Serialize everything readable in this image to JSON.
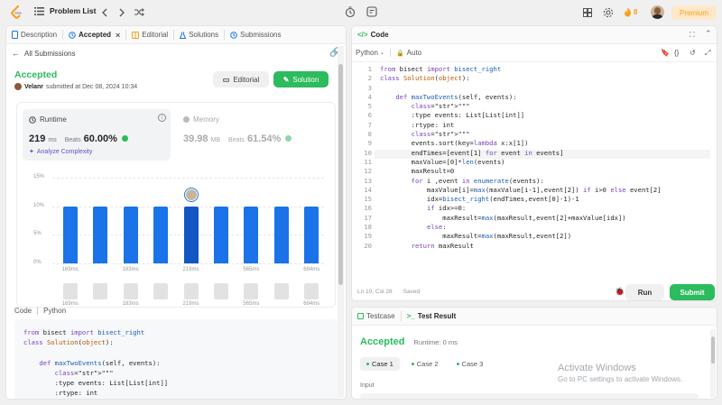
{
  "topbar": {
    "problem_list": "Problem List",
    "streak": "8",
    "premium": "Premium"
  },
  "left_tabs": [
    {
      "label": "Description"
    },
    {
      "label": "Accepted"
    },
    {
      "label": "Editorial"
    },
    {
      "label": "Solutions"
    },
    {
      "label": "Submissions"
    }
  ],
  "submission": {
    "back": "All Submissions",
    "status": "Accepted",
    "user": "Velanr",
    "submitted": "submitted at Dec 08, 2024 10:34",
    "editorial_btn": "Editorial",
    "solution_btn": "Solution",
    "runtime_label": "Runtime",
    "runtime_value": "219",
    "runtime_unit": "ms",
    "beats_label": "Beats",
    "runtime_beats": "60.00%",
    "analyze": "Analyze Complexity",
    "memory_label": "Memory",
    "memory_value": "39.98",
    "memory_unit": "MB",
    "memory_beats": "61.54%"
  },
  "chart_data": {
    "type": "bar",
    "y_ticks": [
      "15%",
      "10%",
      "5%",
      "0%"
    ],
    "ylim": [
      0,
      15
    ],
    "values": [
      10,
      10,
      10,
      10,
      10,
      10,
      10,
      10,
      10
    ],
    "highlight_index": 4,
    "x_labels": [
      "169ms",
      "",
      "183ms",
      "",
      "219ms",
      "",
      "565ms",
      "",
      "684ms"
    ]
  },
  "bottom_code": {
    "label": "Code",
    "lang": "Python",
    "lines": [
      "from bisect import bisect_right",
      "class Solution(object):",
      "",
      "    def maxTwoEvents(self, events):",
      "        \"\"\"",
      "        :type events: List[List[int]]",
      "        :rtype: int"
    ]
  },
  "editor": {
    "title": "Code",
    "lang": "Python",
    "mode": "Auto",
    "status_pos": "Ln 10, Col 28",
    "status_saved": "Saved",
    "run": "Run",
    "submit": "Submit",
    "lines": [
      "from bisect import bisect_right",
      "class Solution(object):",
      "",
      "    def maxTwoEvents(self, events):",
      "        \"\"\"",
      "        :type events: List[List[int]]",
      "        :rtype: int",
      "        \"\"\"",
      "        events.sort(key=lambda x:x[1])",
      "        endTimes=[event[1] for event in events]",
      "        maxValue=[0]*len(events)",
      "        maxResult=0",
      "        for i ,event in enumerate(events):",
      "            maxValue[i]=max(maxValue[i-1],event[2]) if i>0 else event[2]",
      "            idx=bisect_right(endTimes,event[0]-1)-1",
      "            if idx>=0:",
      "                maxResult=max(maxResult,event[2]+maxValue[idx])",
      "            else:",
      "                maxResult=max(maxResult,event[2])",
      "        return maxResult"
    ]
  },
  "result": {
    "testcase_tab": "Testcase",
    "result_tab": "Test Result",
    "status": "Accepted",
    "runtime": "Runtime: 0 ms",
    "cases": [
      "Case 1",
      "Case 2",
      "Case 3"
    ],
    "input_label": "Input"
  },
  "watermark": {
    "line1": "Activate Windows",
    "line2": "Go to PC settings to activate Windows."
  },
  "colors": {
    "accent_green": "#2cbb5d",
    "bar_blue": "#1a73e8",
    "orange": "#f89f1b"
  }
}
